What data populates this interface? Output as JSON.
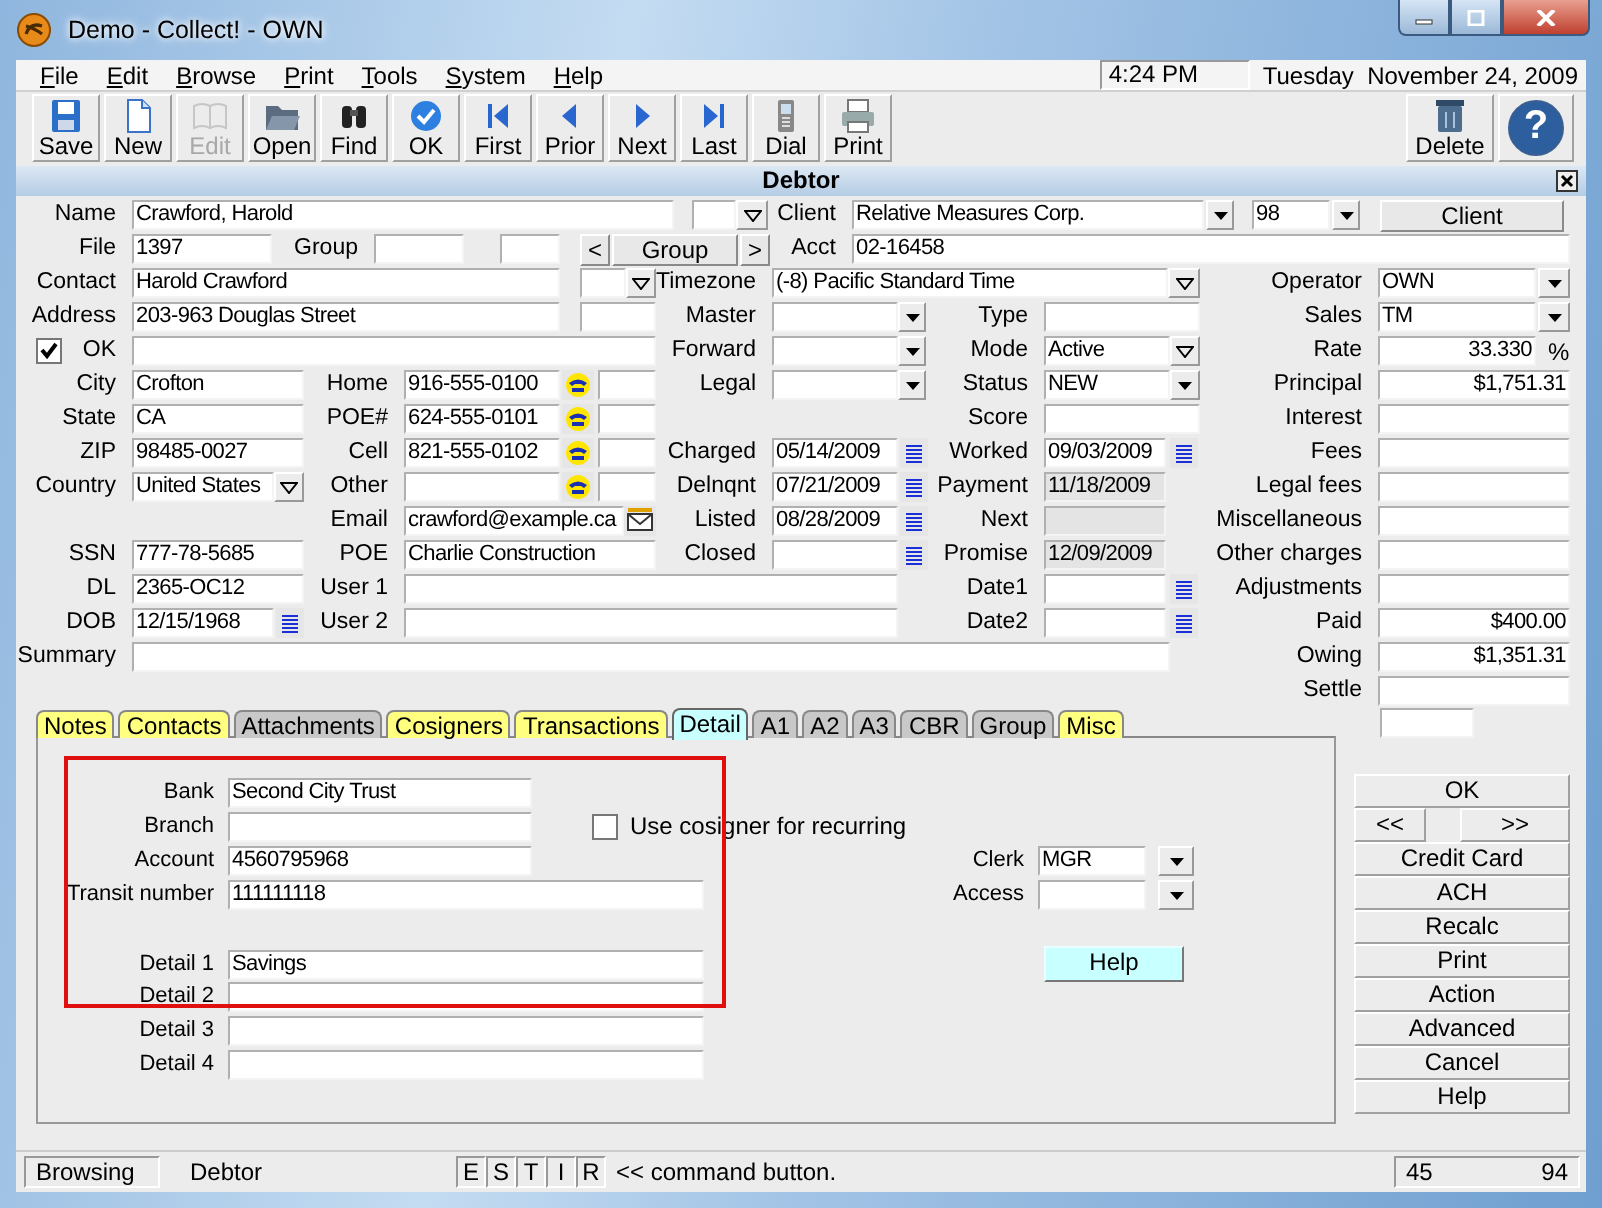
{
  "window": {
    "title": "Demo - Collect! - OWN"
  },
  "menu": [
    "File",
    "Edit",
    "Browse",
    "Print",
    "Tools",
    "System",
    "Help"
  ],
  "clock": {
    "time": "4:24 PM",
    "date": "Tuesday  November 24, 2009"
  },
  "toolbar": [
    {
      "label": "Save",
      "disabled": false
    },
    {
      "label": "New",
      "disabled": false
    },
    {
      "label": "Edit",
      "disabled": true
    },
    {
      "label": "Open",
      "disabled": false
    },
    {
      "label": "Find",
      "disabled": false
    },
    {
      "label": "OK",
      "disabled": false
    },
    {
      "label": "First",
      "disabled": false
    },
    {
      "label": "Prior",
      "disabled": false
    },
    {
      "label": "Next",
      "disabled": false
    },
    {
      "label": "Last",
      "disabled": false
    },
    {
      "label": "Dial",
      "disabled": false
    },
    {
      "label": "Print",
      "disabled": false
    }
  ],
  "toolbar_right": {
    "delete": "Delete",
    "help_glyph": "?"
  },
  "debtor": {
    "title": "Debtor",
    "client_button": "Client",
    "group_button": "Group",
    "prev_button": "<",
    "next_button": ">",
    "fields": {
      "name": {
        "label": "Name",
        "value": "Crawford, Harold"
      },
      "client": {
        "label": "Client",
        "value": "Relative Measures Corp."
      },
      "client_number": {
        "value": "98"
      },
      "file": {
        "label": "File",
        "value": "1397"
      },
      "group": {
        "label": "Group"
      },
      "acct": {
        "label": "Acct",
        "value": "02-16458"
      },
      "contact": {
        "label": "Contact",
        "value": "Harold Crawford"
      },
      "timezone": {
        "label": "Timezone",
        "value": "(-8) Pacific Standard Time"
      },
      "operator": {
        "label": "Operator",
        "value": "OWN"
      },
      "address": {
        "label": "Address",
        "value": "203-963 Douglas Street"
      },
      "master": {
        "label": "Master"
      },
      "type": {
        "label": "Type"
      },
      "sales": {
        "label": "Sales",
        "value": "TM"
      },
      "ok": {
        "label": "OK",
        "checked": true
      },
      "forward": {
        "label": "Forward"
      },
      "mode": {
        "label": "Mode",
        "value": "Active"
      },
      "rate": {
        "label": "Rate",
        "value": "33.330",
        "unit": "%"
      },
      "city": {
        "label": "City",
        "value": "Crofton"
      },
      "home": {
        "label": "Home",
        "value": "916-555-0100"
      },
      "legal": {
        "label": "Legal"
      },
      "status": {
        "label": "Status",
        "value": "NEW"
      },
      "principal": {
        "label": "Principal",
        "value": "$1,751.31"
      },
      "state": {
        "label": "State",
        "value": "CA"
      },
      "poe_phone": {
        "label": "POE#",
        "value": "624-555-0101"
      },
      "score": {
        "label": "Score"
      },
      "interest": {
        "label": "Interest"
      },
      "zip": {
        "label": "ZIP",
        "value": "98485-0027"
      },
      "cell": {
        "label": "Cell",
        "value": "821-555-0102"
      },
      "charged": {
        "label": "Charged",
        "value": "05/14/2009"
      },
      "worked": {
        "label": "Worked",
        "value": "09/03/2009"
      },
      "fees": {
        "label": "Fees"
      },
      "country": {
        "label": "Country",
        "value": "United States"
      },
      "other": {
        "label": "Other"
      },
      "delnqnt": {
        "label": "Delnqnt",
        "value": "07/21/2009"
      },
      "payment": {
        "label": "Payment",
        "value": "11/18/2009"
      },
      "legal_fees": {
        "label": "Legal fees"
      },
      "email": {
        "label": "Email",
        "value": "crawford@example.ca"
      },
      "listed": {
        "label": "Listed",
        "value": "08/28/2009"
      },
      "next": {
        "label": "Next"
      },
      "miscellaneous": {
        "label": "Miscellaneous"
      },
      "ssn": {
        "label": "SSN",
        "value": "777-78-5685"
      },
      "poe": {
        "label": "POE",
        "value": "Charlie Construction"
      },
      "closed": {
        "label": "Closed"
      },
      "promise": {
        "label": "Promise",
        "value": "12/09/2009"
      },
      "other_charges": {
        "label": "Other charges"
      },
      "dl": {
        "label": "DL",
        "value": "2365-OC12"
      },
      "user1": {
        "label": "User 1"
      },
      "date1": {
        "label": "Date1"
      },
      "adjustments": {
        "label": "Adjustments"
      },
      "dob": {
        "label": "DOB",
        "value": "12/15/1968"
      },
      "user2": {
        "label": "User 2"
      },
      "date2": {
        "label": "Date2"
      },
      "paid": {
        "label": "Paid",
        "value": "$400.00"
      },
      "summary": {
        "label": "Summary"
      },
      "owing": {
        "label": "Owing",
        "value": "$1,351.31"
      },
      "settle": {
        "label": "Settle"
      }
    }
  },
  "tabs": [
    {
      "label": "Notes",
      "selected": false,
      "color": "#ffff80"
    },
    {
      "label": "Contacts",
      "selected": false,
      "color": "#ffff80"
    },
    {
      "label": "Attachments",
      "selected": false,
      "color": "#c8c8c8"
    },
    {
      "label": "Cosigners",
      "selected": false,
      "color": "#ffff80"
    },
    {
      "label": "Transactions",
      "selected": false,
      "color": "#ffff80"
    },
    {
      "label": "Detail",
      "selected": true,
      "color": "#c8ffff"
    },
    {
      "label": "A1",
      "selected": false,
      "color": "#c8c8c8"
    },
    {
      "label": "A2",
      "selected": false,
      "color": "#c8c8c8"
    },
    {
      "label": "A3",
      "selected": false,
      "color": "#c8c8c8"
    },
    {
      "label": "CBR",
      "selected": false,
      "color": "#c8c8c8"
    },
    {
      "label": "Group",
      "selected": false,
      "color": "#c8c8c8"
    },
    {
      "label": "Misc",
      "selected": false,
      "color": "#ffff80"
    }
  ],
  "detail": {
    "bank": {
      "label": "Bank",
      "value": "Second City Trust"
    },
    "branch": {
      "label": "Branch"
    },
    "account": {
      "label": "Account",
      "value": "4560795968"
    },
    "transit": {
      "label": "Transit number",
      "value": "111111118"
    },
    "detail1": {
      "label": "Detail 1",
      "value": "Savings"
    },
    "detail2": {
      "label": "Detail 2"
    },
    "detail3": {
      "label": "Detail 3"
    },
    "detail4": {
      "label": "Detail 4"
    },
    "use_cosigner": {
      "label": "Use cosigner for recurring",
      "checked": false
    },
    "clerk": {
      "label": "Clerk",
      "value": "MGR"
    },
    "access": {
      "label": "Access"
    },
    "help_button": "Help"
  },
  "side_buttons": [
    "OK",
    "<<",
    ">>",
    "Credit Card",
    "ACH",
    "Recalc",
    "Print",
    "Action",
    "Advanced",
    "Cancel",
    "Help"
  ],
  "status_bar": {
    "mode": "Browsing",
    "screen": "Debtor",
    "flags": [
      "E",
      "S",
      "T",
      "I",
      "R"
    ],
    "hint": "<< command button.",
    "left_count": "45",
    "right_count": "94"
  }
}
